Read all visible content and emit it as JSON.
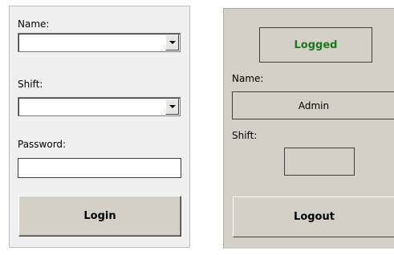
{
  "login_panel": {
    "name_label": "Name:",
    "name_value": "",
    "shift_label": "Shift:",
    "shift_value": "",
    "password_label": "Password:",
    "password_value": "",
    "login_button": "Login"
  },
  "logged_panel": {
    "status_text": "Logged",
    "status_color": "#1a7a1a",
    "name_label": "Name:",
    "name_value": "Admin",
    "shift_label": "Shift:",
    "shift_value": "",
    "logout_button": "Logout"
  }
}
